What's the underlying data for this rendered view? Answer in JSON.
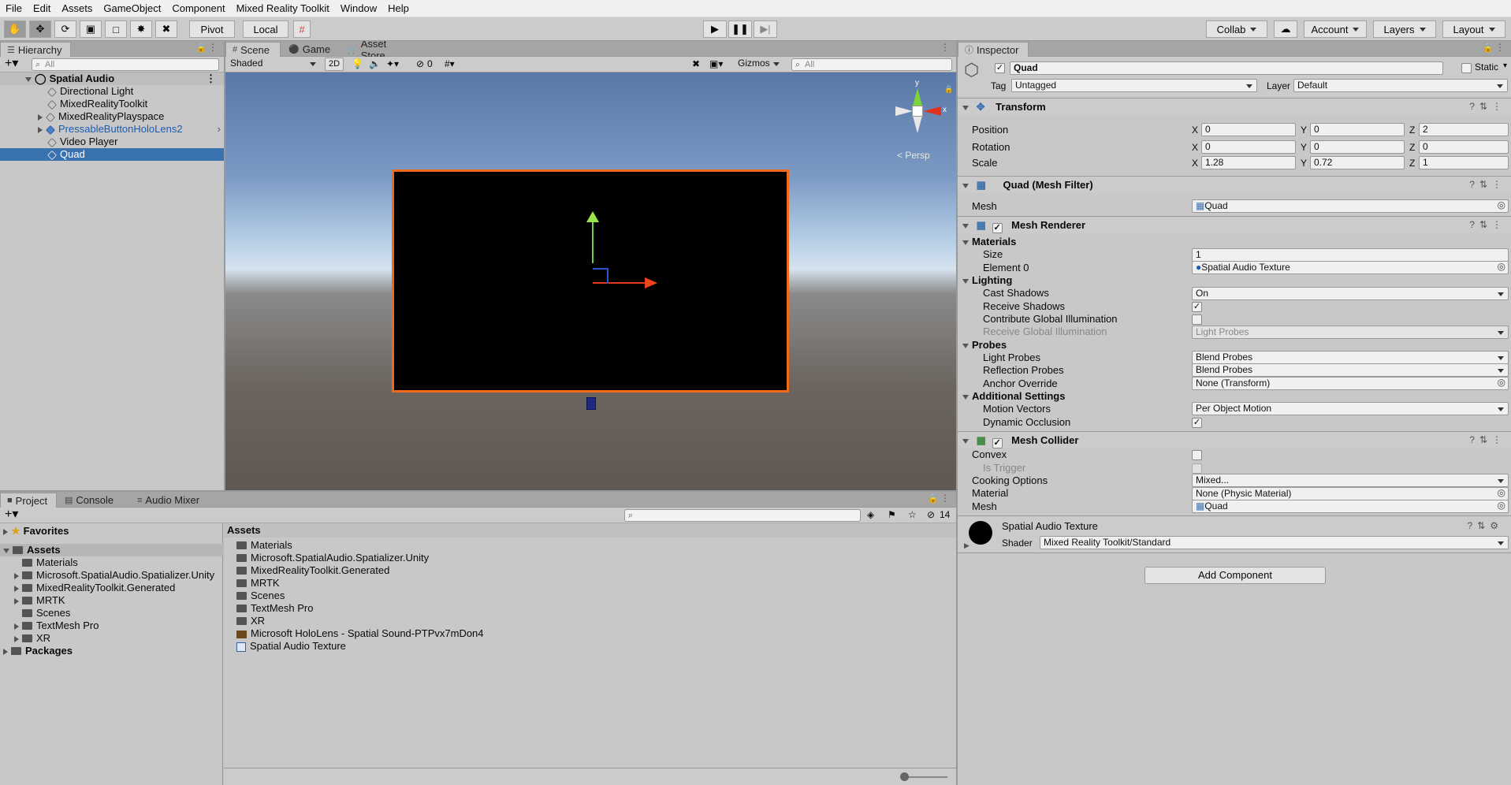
{
  "menu": [
    "File",
    "Edit",
    "Assets",
    "GameObject",
    "Component",
    "Mixed Reality Toolkit",
    "Window",
    "Help"
  ],
  "toolbar": {
    "pivot": "Pivot",
    "local": "Local",
    "collab": "Collab",
    "account": "Account",
    "layers": "Layers",
    "layout": "Layout"
  },
  "hierarchy": {
    "tab": "Hierarchy",
    "search_placeholder": "All",
    "scene": "Spatial Audio",
    "items": [
      {
        "label": "Directional Light"
      },
      {
        "label": "MixedRealityToolkit"
      },
      {
        "label": "MixedRealityPlayspace"
      },
      {
        "label": "PressableButtonHoloLens2"
      },
      {
        "label": "Video Player"
      },
      {
        "label": "Quad"
      }
    ]
  },
  "scene_view": {
    "tabs": [
      "Scene",
      "Game",
      "Asset Store"
    ],
    "shading": "Shaded",
    "mode_2d": "2D",
    "hidden_count": "0",
    "gizmos": "Gizmos",
    "search_placeholder": "All",
    "persp": "< Persp",
    "axis_y": "y",
    "axis_x": "x"
  },
  "project": {
    "tabs": [
      "Project",
      "Console",
      "Audio Mixer"
    ],
    "count": "14",
    "favorites": "Favorites",
    "assets": "Assets",
    "packages": "Packages",
    "tree": [
      "Materials",
      "Microsoft.SpatialAudio.Spatializer.Unity",
      "MixedRealityToolkit.Generated",
      "MRTK",
      "Scenes",
      "TextMesh Pro",
      "XR"
    ],
    "breadcrumb": "Assets",
    "files": [
      "Materials",
      "Microsoft.SpatialAudio.Spatializer.Unity",
      "MixedRealityToolkit.Generated",
      "MRTK",
      "Scenes",
      "TextMesh Pro",
      "XR",
      "Microsoft HoloLens - Spatial Sound-PTPvx7mDon4",
      "Spatial Audio Texture"
    ]
  },
  "inspector": {
    "tab": "Inspector",
    "object_name": "Quad",
    "static": "Static",
    "tag_label": "Tag",
    "tag_value": "Untagged",
    "layer_label": "Layer",
    "layer_value": "Default",
    "transform": {
      "title": "Transform",
      "position_label": "Position",
      "position": [
        "0",
        "0",
        "2"
      ],
      "rotation_label": "Rotation",
      "rotation": [
        "0",
        "0",
        "0"
      ],
      "scale_label": "Scale",
      "scale": [
        "1.28",
        "0.72",
        "1"
      ]
    },
    "mesh_filter": {
      "title": "Quad (Mesh Filter)",
      "mesh_label": "Mesh",
      "mesh": "Quad"
    },
    "mesh_renderer": {
      "title": "Mesh Renderer",
      "materials": "Materials",
      "size_label": "Size",
      "size": "1",
      "element_label": "Element 0",
      "element": "Spatial Audio Texture",
      "lighting": "Lighting",
      "cast_shadows_label": "Cast Shadows",
      "cast_shadows": "On",
      "receive_shadows_label": "Receive Shadows",
      "contribute_gi_label": "Contribute Global Illumination",
      "receive_gi_label": "Receive Global Illumination",
      "receive_gi": "Light Probes",
      "probes": "Probes",
      "light_probes_label": "Light Probes",
      "light_probes": "Blend Probes",
      "reflection_probes_label": "Reflection Probes",
      "reflection_probes": "Blend Probes",
      "anchor_label": "Anchor Override",
      "anchor": "None (Transform)",
      "additional": "Additional Settings",
      "motion_label": "Motion Vectors",
      "motion": "Per Object Motion",
      "occlusion_label": "Dynamic Occlusion"
    },
    "mesh_collider": {
      "title": "Mesh Collider",
      "convex_label": "Convex",
      "trigger_label": "Is Trigger",
      "cooking_label": "Cooking Options",
      "cooking": "Mixed...",
      "material_label": "Material",
      "material": "None (Physic Material)",
      "mesh_label": "Mesh",
      "mesh": "Quad"
    },
    "material": {
      "name": "Spatial Audio Texture",
      "shader_label": "Shader",
      "shader": "Mixed Reality Toolkit/Standard"
    },
    "add_component": "Add Component"
  },
  "colors": {
    "selection": "#3a72b0",
    "outline": "#f06a1a",
    "prefab_text": "#1d5bb0"
  }
}
